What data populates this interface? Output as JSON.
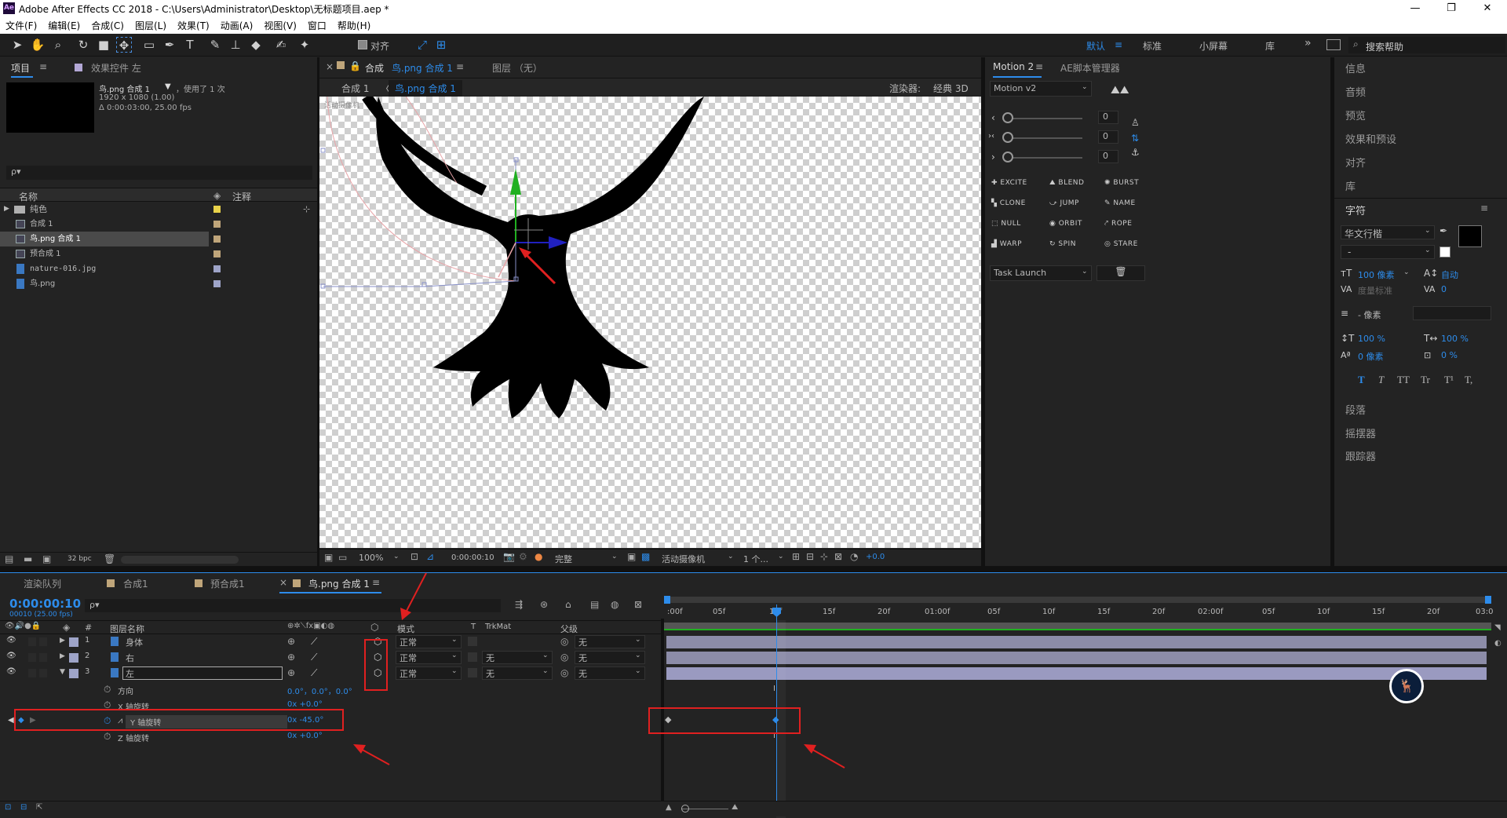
{
  "window": {
    "title": "Adobe After Effects CC 2018 - C:\\Users\\Administrator\\Desktop\\无标题项目.aep *",
    "logo": "Ae",
    "minimize": "—",
    "maximize": "❐",
    "close": "✕"
  },
  "menu": [
    "文件(F)",
    "编辑(E)",
    "合成(C)",
    "图层(L)",
    "效果(T)",
    "动画(A)",
    "视图(V)",
    "窗口",
    "帮助(H)"
  ],
  "toolbar": {
    "align_label": "对齐",
    "workspaces": [
      "默认",
      "标准",
      "小屏幕",
      "库"
    ],
    "search_placeholder": "搜索帮助",
    "more": "»"
  },
  "project": {
    "tab": "项目",
    "effects_tab": "效果控件 左",
    "comp_name": "鸟.png 合成 1",
    "used": "，使用了 1 次",
    "res": "1920 x 1080 (1.00)",
    "dur": "Δ 0:00:03:00, 25.00 fps",
    "search_placeholder": "ρ▾",
    "col_name": "名称",
    "col_note": "注释",
    "items": [
      {
        "name": "纯色",
        "type": "folder",
        "color": "#e8d24a"
      },
      {
        "name": "合成 1",
        "type": "comp",
        "color": "#bfa57a"
      },
      {
        "name": "鸟.png 合成 1",
        "type": "comp",
        "color": "#bfa57a"
      },
      {
        "name": "预合成 1",
        "type": "comp",
        "color": "#bfa57a"
      },
      {
        "name": "nature-016.jpg",
        "type": "file",
        "color": "#9ea4c8"
      },
      {
        "name": "鸟.png",
        "type": "file",
        "color": "#9ea4c8"
      }
    ],
    "bpc": "32 bpc"
  },
  "viewer": {
    "tab": "合成",
    "tab_comp": "鸟.png 合成 1",
    "layer_tab": "图层 （无）",
    "breadcrumb": [
      "合成 1",
      "鸟.png 合成 1"
    ],
    "renderer_label": "渲染器:",
    "renderer_value": "经典 3D",
    "camera_label": "活动摄像机",
    "zoom": "100%",
    "time": "0:00:00:10",
    "quality": "完整",
    "views": "1 个...",
    "exposure": "+0.0"
  },
  "motion": {
    "tab": "Motion 2",
    "tab2": "AE脚本管理器",
    "version": "Motion v2",
    "slider_values": [
      "0",
      "0",
      "0"
    ],
    "buttons": [
      "EXCITE",
      "BLEND",
      "BURST",
      "CLONE",
      "JUMP",
      "NAME",
      "NULL",
      "ORBIT",
      "ROPE",
      "WARP",
      "SPIN",
      "STARE"
    ],
    "task": "Task Launch"
  },
  "right_panels": [
    "信息",
    "音频",
    "预览",
    "效果和预设",
    "对齐",
    "库"
  ],
  "character": {
    "title": "字符",
    "font": "华文行楷",
    "style": "-",
    "size": "100 像素",
    "leading": "自动",
    "kerning": "度量标准",
    "tracking": "0",
    "stroke": "- 像素",
    "vscale": "100 %",
    "hscale": "100 %",
    "baseline": "0 像素",
    "tsume": "0 %",
    "styles": [
      "T",
      "T",
      "TT",
      "Tr",
      "T¹",
      "T,"
    ]
  },
  "right_panels2": [
    "段落",
    "摇摆器",
    "跟踪器"
  ],
  "timeline": {
    "tabs": [
      "渲染队列",
      "合成1",
      "预合成1",
      "鸟.png 合成 1"
    ],
    "timecode": "0:00:00:10",
    "frames": "00010 (25.00 fps)",
    "search_placeholder": "ρ▾",
    "col_num": "#",
    "col_name": "图层名称",
    "col_mode": "模式",
    "col_t": "T",
    "col_trkmat": "TrkMat",
    "col_parent": "父级",
    "ruler": [
      ":00f",
      "05f",
      "10f",
      "15f",
      "20f",
      "01:00f",
      "05f",
      "10f",
      "15f",
      "20f",
      "02:00f",
      "05f",
      "10f",
      "15f",
      "20f",
      "03:0"
    ],
    "layers": [
      {
        "num": "1",
        "name": "身体",
        "mode": "正常",
        "trkmat": "",
        "parent": "无"
      },
      {
        "num": "2",
        "name": "右",
        "mode": "正常",
        "trkmat": "无",
        "parent": "无"
      },
      {
        "num": "3",
        "name": "左",
        "mode": "正常",
        "trkmat": "无",
        "parent": "无"
      }
    ],
    "props": [
      {
        "name": "方向",
        "value": "0.0°，0.0°，0.0°"
      },
      {
        "name": "X 轴旋转",
        "value": "0x +0.0°"
      },
      {
        "name": "Y 轴旋转",
        "value": "0x -45.0°"
      },
      {
        "name": "Z 轴旋转",
        "value": "0x +0.0°"
      }
    ],
    "playhead_frame": 10,
    "total_frames": 75
  }
}
